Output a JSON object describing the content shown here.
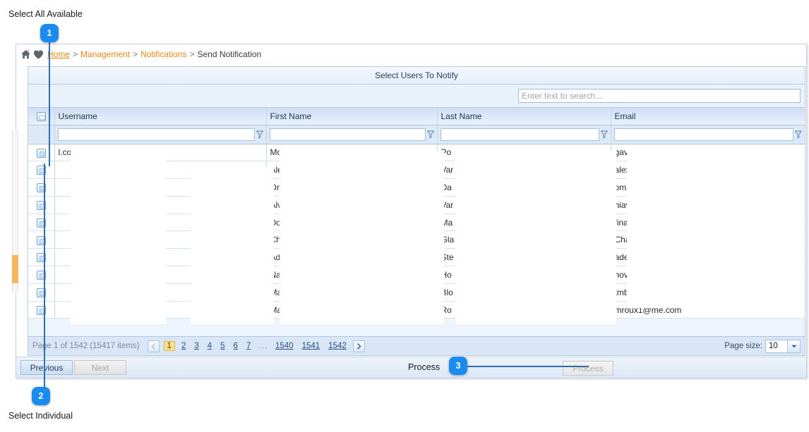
{
  "annotations": [
    {
      "n": "1",
      "label": "Select All Available"
    },
    {
      "n": "2",
      "label": "Select Individual"
    },
    {
      "n": "3",
      "label": "Process"
    }
  ],
  "breadcrumb": {
    "home_icon": "home-icon",
    "favorite_icon": "heart-icon",
    "items": [
      {
        "text": "Home",
        "link": true
      },
      {
        "text": "Management",
        "link": true
      },
      {
        "text": "Notifications",
        "link": true
      },
      {
        "text": "Send Notification",
        "link": false
      }
    ],
    "separator": ">"
  },
  "grid": {
    "title": "Select Users To Notify",
    "search": {
      "placeholder": "Enter text to search...",
      "value": ""
    },
    "columns": [
      {
        "key": "checkbox",
        "label": ""
      },
      {
        "key": "username",
        "label": "Username"
      },
      {
        "key": "firstname",
        "label": "First Name"
      },
      {
        "key": "lastname",
        "label": "Last Name"
      },
      {
        "key": "email",
        "label": "Email"
      }
    ],
    "filters": {
      "username": "",
      "firstname": "",
      "lastname": "",
      "email": ""
    },
    "filter_icon": "funnel-icon",
    "rows": [
      {
        "username": "l.co.za",
        "firstname": "Mo",
        "lastname": "Po",
        "email": "gav"
      },
      {
        "username": "",
        "firstname": "Ale",
        "lastname": "Var",
        "email": "alex"
      },
      {
        "username": "",
        "firstname": "Om",
        "lastname": "Da",
        "email": "oma"
      },
      {
        "username": "",
        "firstname": "Alv",
        "lastname": "Var",
        "email": "hiav"
      },
      {
        "username": "",
        "firstname": "Do",
        "lastname": "Ma",
        "email": "fina"
      },
      {
        "username": "",
        "firstname": "Ch",
        "lastname": "Gla",
        "email": "Cha"
      },
      {
        "username": "",
        "firstname": "Ad",
        "lastname": "Ste",
        "email": "ade"
      },
      {
        "username": "",
        "firstname": "Na",
        "lastname": "Ho",
        "email": "hov"
      },
      {
        "username": "",
        "firstname": "Ma",
        "lastname": "Blo",
        "email": "tmb"
      },
      {
        "username": "",
        "firstname": "Ma",
        "lastname": "Ro",
        "email": "mroux1@me.com"
      }
    ]
  },
  "pager": {
    "info": "Page 1 of 1542 (15417 items)",
    "prev_icon": "chevron-left-icon",
    "next_icon": "chevron-right-icon",
    "pages": [
      "1",
      "2",
      "3",
      "4",
      "5",
      "6",
      "7"
    ],
    "current_page": "1",
    "ellipsis": "...",
    "tail_pages": [
      "1540",
      "1541",
      "1542"
    ],
    "page_size_label": "Page size:",
    "page_size_value": "10",
    "page_size_arrow": "chevron-down-icon"
  },
  "footer": {
    "previous_label": "Previous",
    "next_label": "Next",
    "process_label": "Process"
  },
  "colors": {
    "accent_blue": "#1a8cf0",
    "link_orange": "#e8861e",
    "header_blue": "#cfdef3",
    "current_page_yellow": "#ffdf8a",
    "scroll_orange": "#f5b75e"
  }
}
